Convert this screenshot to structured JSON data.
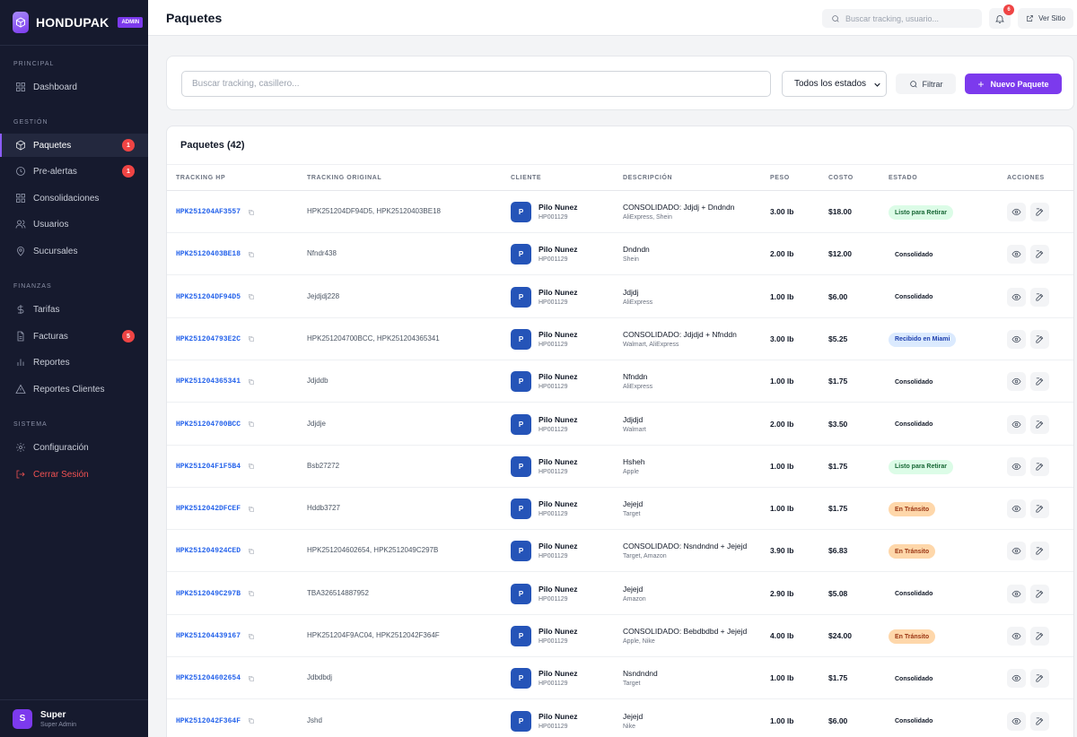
{
  "brand": {
    "name": "HONDUPAK",
    "badge": "ADMIN"
  },
  "sidebar": {
    "sections": {
      "principal": "PRINCIPAL",
      "gestion": "GESTIÓN",
      "finanzas": "FINANZAS",
      "sistema": "SISTEMA"
    },
    "items": [
      {
        "label": "Dashboard",
        "icon": "grid-icon"
      },
      {
        "label": "Paquetes",
        "icon": "box-icon",
        "badge": "1",
        "active": true
      },
      {
        "label": "Pre-alertas",
        "icon": "clock-icon",
        "badge": "1"
      },
      {
        "label": "Consolidaciones",
        "icon": "layers-icon"
      },
      {
        "label": "Usuarios",
        "icon": "users-icon"
      },
      {
        "label": "Sucursales",
        "icon": "map-pin-icon"
      },
      {
        "label": "Tarifas",
        "icon": "dollar-icon"
      },
      {
        "label": "Facturas",
        "icon": "invoice-icon",
        "badge": "5"
      },
      {
        "label": "Reportes",
        "icon": "bar-chart-icon"
      },
      {
        "label": "Reportes Clientes",
        "icon": "alert-triangle-icon"
      },
      {
        "label": "Configuración",
        "icon": "gear-icon"
      },
      {
        "label": "Cerrar Sesión",
        "icon": "logout-icon"
      }
    ],
    "user": {
      "initial": "S",
      "name": "Super",
      "role": "Super Admin"
    }
  },
  "header": {
    "title": "Paquetes",
    "search_placeholder": "Buscar tracking, usuario...",
    "notification_count": "6",
    "view_site": "Ver Sitio"
  },
  "filters": {
    "search_placeholder": "Buscar tracking, casillero...",
    "status_selected": "Todos los estados",
    "filter_label": "Filtrar",
    "new_label": "Nuevo Paquete",
    "new_plus": "+"
  },
  "table": {
    "title": "Paquetes (42)",
    "columns": [
      "TRACKING HP",
      "TRACKING ORIGINAL",
      "CLIENTE",
      "DESCRIPCIÓN",
      "PESO",
      "COSTO",
      "ESTADO",
      "ACCIONES"
    ],
    "rows": [
      {
        "hp": "HPK251204AF3557",
        "orig": "HPK251204DF94D5, HPK25120403BE18",
        "initial": "P",
        "client": "Pilo Nunez",
        "code": "HP001129",
        "desc": "CONSOLIDADO: Jdjdj + Dndndn",
        "store": "AliExpress, Shein",
        "weight": "3.00 lb",
        "cost": "$18.00",
        "status": "Listo para Retirar",
        "tone": "green"
      },
      {
        "hp": "HPK25120403BE18",
        "orig": "Nfndr438",
        "initial": "P",
        "client": "Pilo Nunez",
        "code": "HP001129",
        "desc": "Dndndn",
        "store": "Shein",
        "weight": "2.00 lb",
        "cost": "$12.00",
        "status": "Consolidado",
        "tone": "gray"
      },
      {
        "hp": "HPK251204DF94D5",
        "orig": "Jejdjdj228",
        "initial": "P",
        "client": "Pilo Nunez",
        "code": "HP001129",
        "desc": "Jdjdj",
        "store": "AliExpress",
        "weight": "1.00 lb",
        "cost": "$6.00",
        "status": "Consolidado",
        "tone": "gray"
      },
      {
        "hp": "HPK251204793E2C",
        "orig": "HPK251204700BCC, HPK251204365341",
        "initial": "P",
        "client": "Pilo Nunez",
        "code": "HP001129",
        "desc": "CONSOLIDADO: Jdjdjd + Nfnddn",
        "store": "Walmart, AliExpress",
        "weight": "3.00 lb",
        "cost": "$5.25",
        "status": "Recibido en Miami",
        "tone": "blue"
      },
      {
        "hp": "HPK251204365341",
        "orig": "Jdjddb",
        "initial": "P",
        "client": "Pilo Nunez",
        "code": "HP001129",
        "desc": "Nfnddn",
        "store": "AliExpress",
        "weight": "1.00 lb",
        "cost": "$1.75",
        "status": "Consolidado",
        "tone": "gray"
      },
      {
        "hp": "HPK251204700BCC",
        "orig": "Jdjdje",
        "initial": "P",
        "client": "Pilo Nunez",
        "code": "HP001129",
        "desc": "Jdjdjd",
        "store": "Walmart",
        "weight": "2.00 lb",
        "cost": "$3.50",
        "status": "Consolidado",
        "tone": "gray"
      },
      {
        "hp": "HPK251204F1F5B4",
        "orig": "Bsb27272",
        "initial": "P",
        "client": "Pilo Nunez",
        "code": "HP001129",
        "desc": "Hsheh",
        "store": "Apple",
        "weight": "1.00 lb",
        "cost": "$1.75",
        "status": "Listo para Retirar",
        "tone": "green"
      },
      {
        "hp": "HPK2512042DFCEF",
        "orig": "Hddb3727",
        "initial": "P",
        "client": "Pilo Nunez",
        "code": "HP001129",
        "desc": "Jejejd",
        "store": "Target",
        "weight": "1.00 lb",
        "cost": "$1.75",
        "status": "En Tránsito",
        "tone": "orange"
      },
      {
        "hp": "HPK251204924CED",
        "orig": "HPK251204602654, HPK2512049C297B",
        "initial": "P",
        "client": "Pilo Nunez",
        "code": "HP001129",
        "desc": "CONSOLIDADO: Nsndndnd + Jejejd",
        "store": "Target, Amazon",
        "weight": "3.90 lb",
        "cost": "$6.83",
        "status": "En Tránsito",
        "tone": "orange"
      },
      {
        "hp": "HPK2512049C297B",
        "orig": "TBA326514887952",
        "initial": "P",
        "client": "Pilo Nunez",
        "code": "HP001129",
        "desc": "Jejejd",
        "store": "Amazon",
        "weight": "2.90 lb",
        "cost": "$5.08",
        "status": "Consolidado",
        "tone": "gray"
      },
      {
        "hp": "HPK251204439167",
        "orig": "HPK251204F9AC04, HPK2512042F364F",
        "initial": "P",
        "client": "Pilo Nunez",
        "code": "HP001129",
        "desc": "CONSOLIDADO: Bebdbdbd + Jejejd",
        "store": "Apple, Nike",
        "weight": "4.00 lb",
        "cost": "$24.00",
        "status": "En Tránsito",
        "tone": "orange"
      },
      {
        "hp": "HPK251204602654",
        "orig": "Jdbdbdj",
        "initial": "P",
        "client": "Pilo Nunez",
        "code": "HP001129",
        "desc": "Nsndndnd",
        "store": "Target",
        "weight": "1.00 lb",
        "cost": "$1.75",
        "status": "Consolidado",
        "tone": "gray"
      },
      {
        "hp": "HPK2512042F364F",
        "orig": "Jshd",
        "initial": "P",
        "client": "Pilo Nunez",
        "code": "HP001129",
        "desc": "Jejejd",
        "store": "Nike",
        "weight": "1.00 lb",
        "cost": "$6.00",
        "status": "Consolidado",
        "tone": "gray"
      }
    ]
  }
}
